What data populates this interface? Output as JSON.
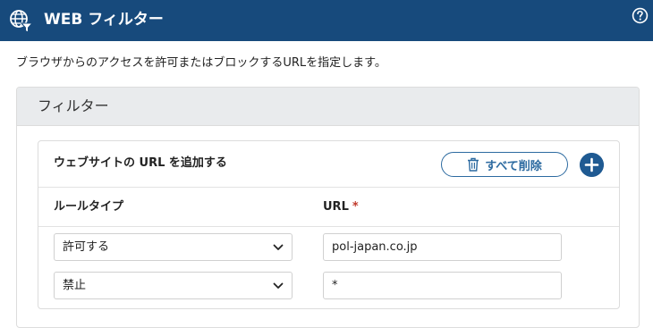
{
  "header": {
    "title": "WEB フィルター",
    "icon": "globe-filter-icon",
    "help_icon": "help-circle-icon",
    "background": "#174a7c"
  },
  "description": "ブラウザからのアクセスを許可またはブロックするURLを指定します。",
  "panel": {
    "title": "フィルター"
  },
  "card": {
    "title": "ウェブサイトの URL を追加する",
    "delete_all_label": "すべて削除",
    "delete_icon": "trash-icon",
    "add_icon": "plus-circle-icon",
    "accent": "#1f5a92"
  },
  "columns": {
    "rule_type": "ルールタイプ",
    "url": "URL",
    "required_mark": "*",
    "required_color": "#c0392b"
  },
  "rows": [
    {
      "rule": "許可する",
      "url": "pol-japan.co.jp"
    },
    {
      "rule": "禁止",
      "url": "*"
    }
  ]
}
